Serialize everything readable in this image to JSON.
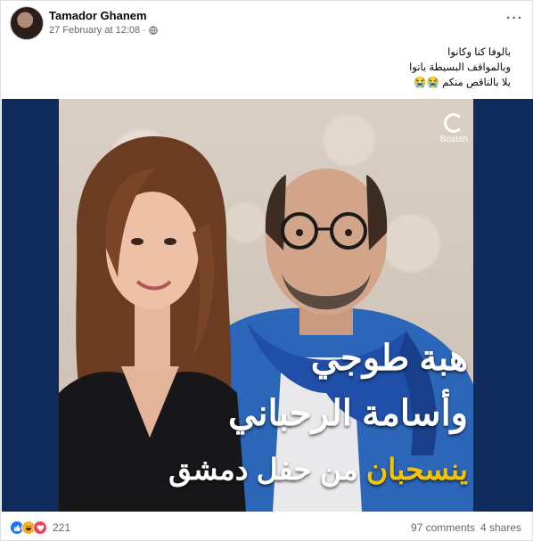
{
  "post": {
    "author": "Tamador Ghanem",
    "timestamp": "27 February at 12:08",
    "separator": "·",
    "more_label": "···",
    "caption_lines": [
      "بالوفا كنا وكانوا",
      "وبالمواقف البسيطة بانوا",
      "يلا بالناقص منكم 😭😭"
    ]
  },
  "image": {
    "logo_text": "Bostah",
    "headline_line1": "هبة طوجي",
    "headline_line2": "وأسامة الرحباني",
    "headline_line3_accent": "ينسحبان",
    "headline_line3_rest": "من حفل دمشق",
    "accent_color": "#f5c400",
    "background_color": "#0f2b5c"
  },
  "footer": {
    "reaction_icons": [
      "like-icon",
      "haha-icon",
      "love-icon"
    ],
    "reaction_count": "221",
    "comments": "97 comments",
    "shares": "4 shares"
  },
  "colors": {
    "like": "#1877f2",
    "haha": "#f7b125",
    "love": "#f33e58"
  }
}
